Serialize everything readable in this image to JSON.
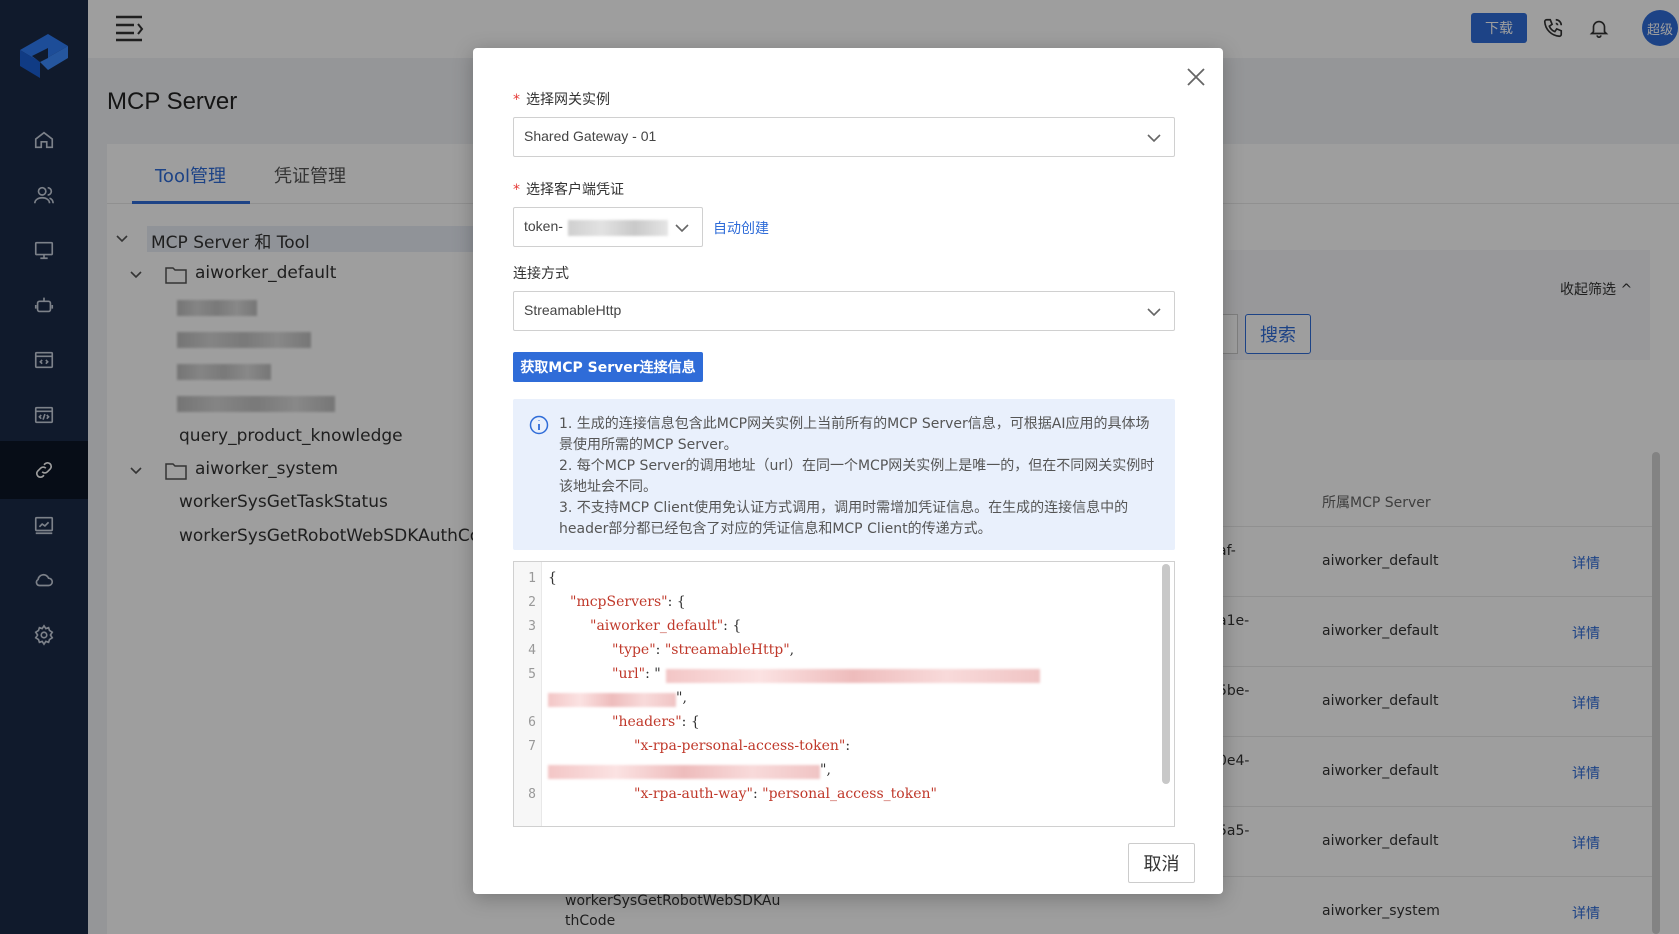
{
  "header": {
    "download_label": "下载",
    "avatar_label": "超级"
  },
  "page": {
    "title": "MCP Server"
  },
  "tabs": [
    {
      "label": "Tool管理"
    },
    {
      "label": "凭证管理"
    }
  ],
  "tree": {
    "root": "MCP Server 和 Tool",
    "folders": [
      {
        "name": "aiworker_default",
        "children": [
          "query_product_knowledge"
        ]
      },
      {
        "name": "aiworker_system",
        "children": [
          "workerSysGetTaskStatus",
          "workerSysGetRobotWebSDKAuthCode"
        ]
      }
    ]
  },
  "filters": {
    "collapse_label": "收起筛选 ^",
    "search_label": "搜索"
  },
  "table": {
    "col_server": "所属MCP Server",
    "rows": [
      {
        "frag": "af-",
        "server": "aiworker_default",
        "action": "详情"
      },
      {
        "frag": "a1e-",
        "server": "aiworker_default",
        "action": "详情"
      },
      {
        "frag": "5be-",
        "server": "aiworker_default",
        "action": "详情"
      },
      {
        "frag": "0e4-",
        "server": "aiworker_default",
        "action": "详情"
      },
      {
        "frag": "5a5-",
        "server": "aiworker_default",
        "action": "详情"
      },
      {
        "name_l1": "workerSysGetRobotWebSDKAu",
        "name_l2": "thCode",
        "server": "aiworker_system",
        "action": "详情"
      }
    ]
  },
  "modal": {
    "gateway_label": "选择网关实例",
    "gateway_value": "Shared Gateway - 01",
    "credential_label": "选择客户端凭证",
    "credential_prefix": "token-",
    "auto_create": "自动创建",
    "conn_label": "连接方式",
    "conn_value": "StreamableHttp",
    "fetch_button": "获取MCP Server连接信息",
    "info_lines": [
      "1. 生成的连接信息包含此MCP网关实例上当前所有的MCP Server信息，可根据AI应用的具体场景使用所需的MCP Server。",
      "2. 每个MCP Server的调用地址（url）在同一个MCP网关实例上是唯一的，但在不同网关实例时该地址会不同。",
      "3. 不支持MCP Client使用免认证方式调用，调用时需增加凭证信息。在生成的连接信息中的header部分都已经包含了对应的凭证信息和MCP Client的传递方式。"
    ],
    "code": {
      "line1": "{",
      "key_mcp": "\"mcpServers\"",
      "key_default": "\"aiworker_default\"",
      "key_type": "\"type\"",
      "val_type": "\"streamableHttp\"",
      "key_url": "\"url\"",
      "key_headers": "\"headers\"",
      "key_token": "\"x-rpa-personal-access-token\"",
      "key_auth": "\"x-rpa-auth-way\"",
      "val_auth": "\"personal_access_token\"",
      "line_numbers": [
        "1",
        "2",
        "3",
        "4",
        "5",
        "6",
        "7",
        "8"
      ]
    },
    "cancel_label": "取消"
  },
  "colors": {
    "primary": "#2f6cd8",
    "sidebar": "#1a2a47",
    "required": "#e53935",
    "code_string": "#c0392b"
  }
}
